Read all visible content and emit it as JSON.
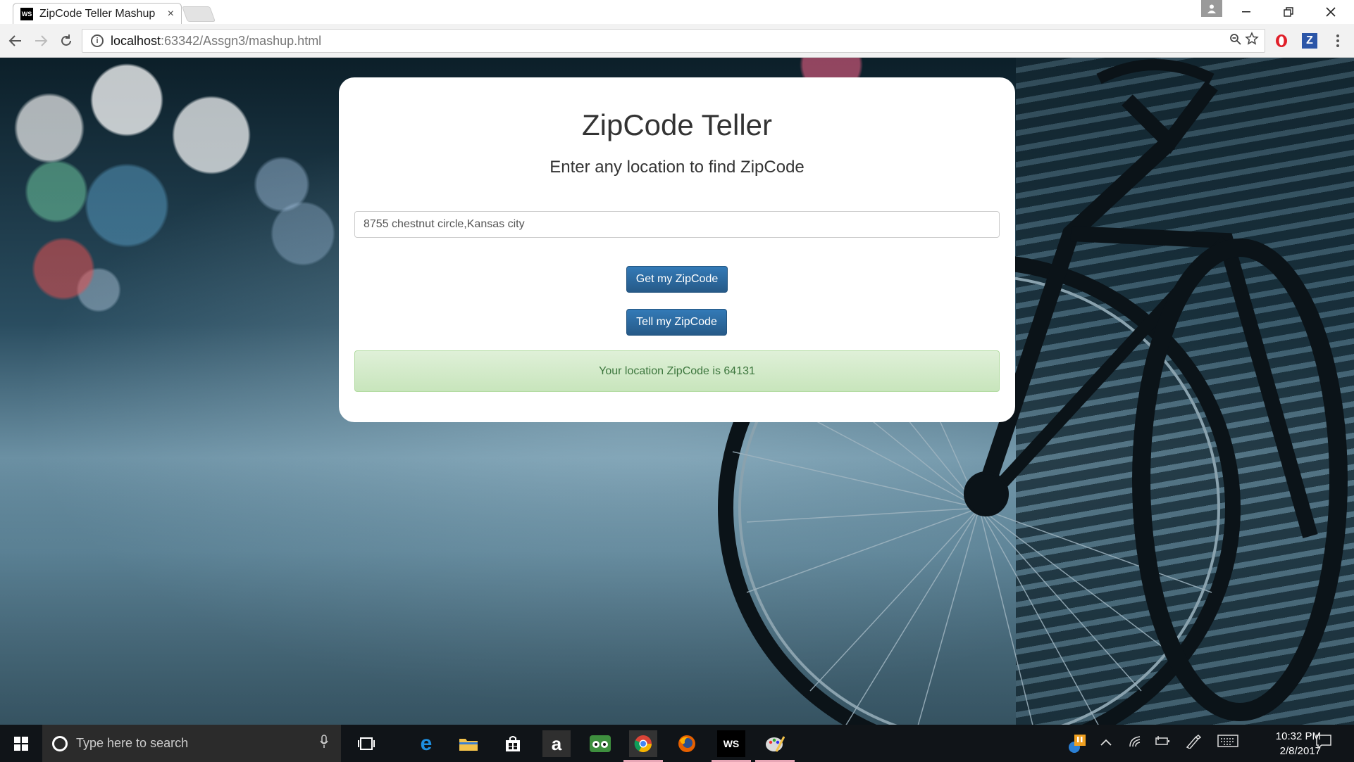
{
  "browser": {
    "tab_title": "ZipCode Teller Mashup",
    "tab_favicon": "WS",
    "tab_close": "×",
    "url_host": "localhost",
    "url_path": ":63342/Assgn3/mashup.html",
    "extension_z": "Z"
  },
  "page": {
    "title": "ZipCode Teller",
    "subtitle": "Enter any location to find ZipCode",
    "location_value": "8755 chestnut circle,Kansas city",
    "get_button": "Get my ZipCode",
    "tell_button": "Tell my ZipCode",
    "result_text": "Your location ZipCode is 64131"
  },
  "taskbar": {
    "search_placeholder": "Type here to search",
    "time": "10:32 PM",
    "date": "2/8/2017"
  },
  "colors": {
    "button": "#337ab7",
    "result_bg": "#dff0d8",
    "result_text": "#3c763d"
  }
}
